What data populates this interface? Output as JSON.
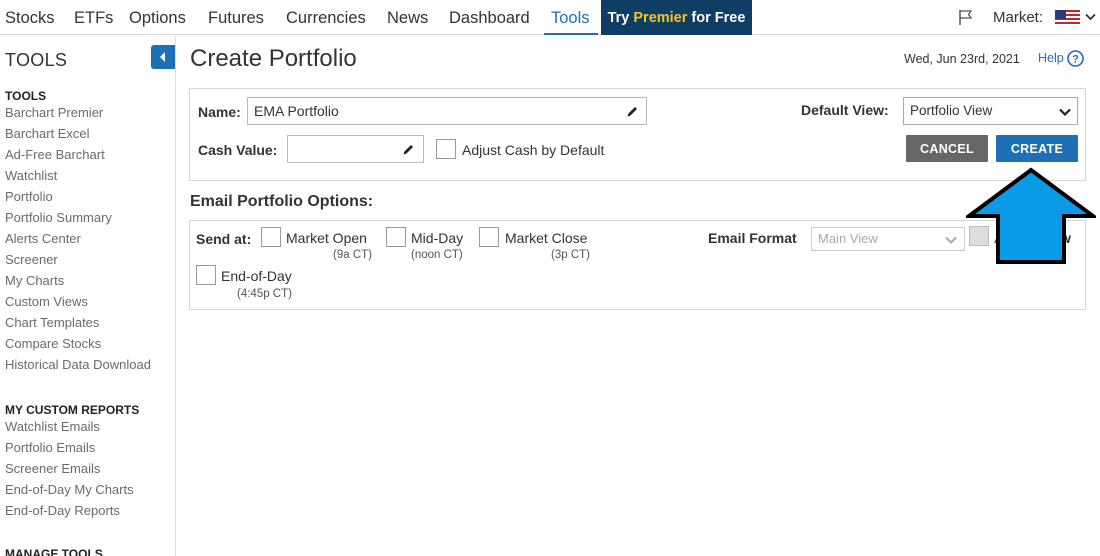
{
  "nav": {
    "items": [
      "Stocks",
      "ETFs",
      "Options",
      "Futures",
      "Currencies",
      "News",
      "Dashboard",
      "Tools"
    ],
    "premier_prefix": "Try ",
    "premier_highlight": "Premier",
    "premier_suffix": " for Free",
    "market_label": "Market:"
  },
  "sidebar": {
    "heading": "TOOLS",
    "sections": [
      {
        "title": "TOOLS",
        "links": [
          "Barchart Premier",
          "Barchart Excel",
          "Ad-Free Barchart",
          "Watchlist",
          "Portfolio",
          "Portfolio Summary",
          "Alerts Center",
          "Screener",
          "My Charts",
          "Custom Views",
          "Chart Templates",
          "Compare Stocks",
          "Historical Data Download"
        ]
      },
      {
        "title": "MY CUSTOM REPORTS",
        "links": [
          "Watchlist Emails",
          "Portfolio Emails",
          "Screener Emails",
          "End-of-Day My Charts",
          "End-of-Day Reports"
        ]
      },
      {
        "title": "MANAGE TOOLS",
        "links": []
      }
    ]
  },
  "page": {
    "title": "Create Portfolio",
    "date": "Wed, Jun 23rd, 2021",
    "help": "Help"
  },
  "form": {
    "name_label": "Name:",
    "name_value": "EMA Portfolio",
    "cash_label": "Cash Value:",
    "cash_value": "",
    "adjust_cash_label": "Adjust Cash by Default",
    "default_view_label": "Default View:",
    "default_view_value": "Portfolio View",
    "cancel": "CANCEL",
    "create": "CREATE"
  },
  "email": {
    "title": "Email Portfolio Options:",
    "send_at_label": "Send at:",
    "options": [
      {
        "label": "Market Open",
        "time": "(9a CT)"
      },
      {
        "label": "Mid-Day",
        "time": "(noon CT)"
      },
      {
        "label": "Market Close",
        "time": "(3p CT)"
      },
      {
        "label": "End-of-Day",
        "time": "(4:45p CT)"
      }
    ],
    "format_label": "Email Format",
    "format_value": "Main View",
    "trailing_label_start": "A",
    "trailing_label_end": "w"
  },
  "colors": {
    "accent": "#1e6fb5",
    "premier_bg": "#0e3e63",
    "premier_highlight": "#f7c325",
    "cancel_bg": "#666666",
    "create_bg": "#1e6fb5",
    "annotation_arrow": "#0a9be6"
  },
  "icons": [
    "flag-icon",
    "us-flag-icon",
    "chevron-down-icon",
    "collapse-arrow-icon",
    "help-icon",
    "pencil-icon",
    "up-arrow-annotation"
  ]
}
